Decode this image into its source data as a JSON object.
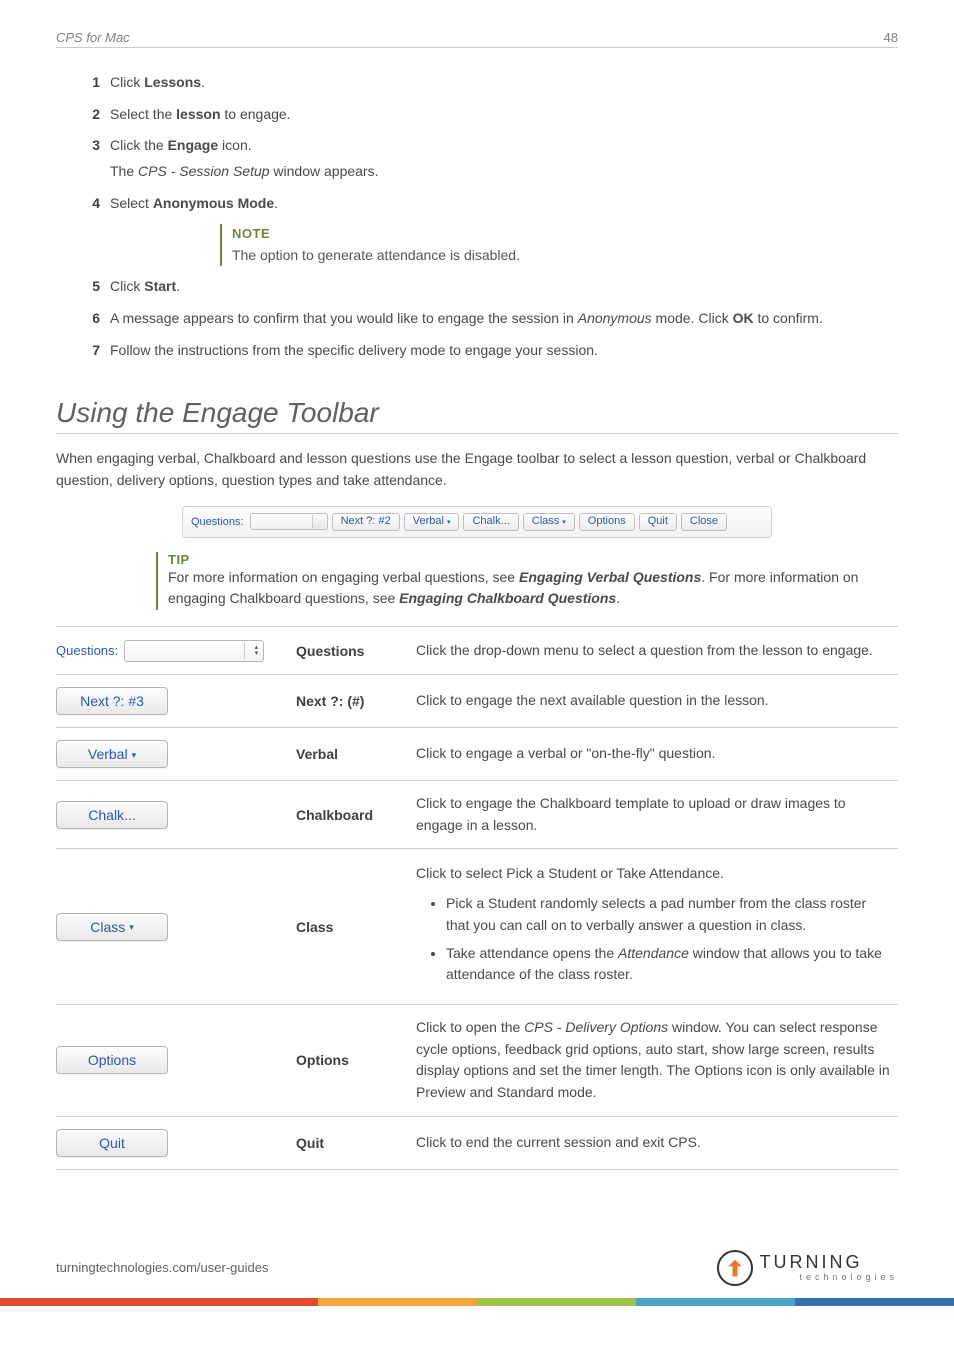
{
  "header": {
    "product": "CPS for Mac",
    "page_number": "48"
  },
  "steps": [
    {
      "num": "1",
      "body": [
        [
          "Click ",
          ""
        ],
        [
          "Lessons",
          "b"
        ],
        [
          ".",
          ""
        ]
      ]
    },
    {
      "num": "2",
      "body": [
        [
          "Select the ",
          ""
        ],
        [
          "lesson",
          "b"
        ],
        [
          " to engage.",
          ""
        ]
      ]
    },
    {
      "num": "3",
      "body": [
        [
          "Click the ",
          ""
        ],
        [
          "Engage",
          "b"
        ],
        [
          " icon.",
          ""
        ]
      ],
      "sub": [
        [
          "The ",
          ""
        ],
        [
          "CPS - Session Setup",
          "i"
        ],
        [
          " window appears.",
          ""
        ]
      ]
    },
    {
      "num": "4",
      "body": [
        [
          "Select ",
          ""
        ],
        [
          "Anonymous Mode",
          "b"
        ],
        [
          ".",
          ""
        ]
      ]
    },
    {
      "num": "5",
      "body": [
        [
          "Click ",
          ""
        ],
        [
          "Start",
          "b"
        ],
        [
          ".",
          ""
        ]
      ]
    },
    {
      "num": "6",
      "body": [
        [
          "A message appears to confirm that you would like to engage the session in ",
          ""
        ],
        [
          "Anonymous",
          "i"
        ],
        [
          " mode. Click ",
          ""
        ],
        [
          "OK",
          "b"
        ],
        [
          " to confirm.",
          ""
        ]
      ]
    },
    {
      "num": "7",
      "body": [
        [
          "Follow the instructions from the specific delivery mode to engage your session.",
          ""
        ]
      ]
    }
  ],
  "note": {
    "title": "NOTE",
    "body": "The option to generate attendance is disabled.",
    "after_step_index": 3
  },
  "section": {
    "title": "Using the Engage Toolbar",
    "intro": "When engaging verbal, Chalkboard and lesson questions use the Engage toolbar to select a lesson question, verbal or Chalkboard question, delivery options, question types and take attendance."
  },
  "toolbar": {
    "questions_label": "Questions:",
    "buttons": {
      "next": "Next ?: #2",
      "verbal": "Verbal",
      "chalk": "Chalk...",
      "class": "Class",
      "options": "Options",
      "quit": "Quit",
      "close": "Close"
    }
  },
  "tip": {
    "title": "TIP",
    "parts": [
      [
        "For more information on engaging verbal questions, see ",
        ""
      ],
      [
        "Engaging Verbal Questions",
        "bi"
      ],
      [
        ". For more information on engaging Chalkboard questions, see ",
        ""
      ],
      [
        "Engaging Chalkboard Questions",
        "bi"
      ],
      [
        ".",
        ""
      ]
    ]
  },
  "reference": [
    {
      "img_type": "select",
      "img_label": "Questions:",
      "name": "Questions",
      "desc": [
        [
          "Click the drop-down menu to select a question from the lesson to engage.",
          ""
        ]
      ]
    },
    {
      "img_type": "button",
      "img_label": "Next ?: #3",
      "name": "Next ?: (#)",
      "desc": [
        [
          "Click to engage the next available question in the lesson.",
          ""
        ]
      ]
    },
    {
      "img_type": "button_dd",
      "img_label": "Verbal",
      "name": "Verbal",
      "desc": [
        [
          "Click to engage a verbal or \"on-the-fly\" question.",
          ""
        ]
      ]
    },
    {
      "img_type": "button",
      "img_label": "Chalk...",
      "name": "Chalkboard",
      "desc": [
        [
          "Click to engage the Chalkboard template to upload or draw images to engage in a lesson.",
          ""
        ]
      ]
    },
    {
      "img_type": "button_dd",
      "img_label": "Class",
      "name": "Class",
      "desc": [
        [
          "Click to select Pick a Student or Take Attendance.",
          ""
        ]
      ],
      "bullets": [
        [
          [
            "Pick a Student randomly selects a pad number from the class roster that you can call on to verbally answer a question in class.",
            ""
          ]
        ],
        [
          [
            "Take attendance opens the ",
            ""
          ],
          [
            "Attendance",
            "i"
          ],
          [
            " window that allows you to take attendance of the class roster.",
            ""
          ]
        ]
      ]
    },
    {
      "img_type": "button",
      "img_label": "Options",
      "name": "Options",
      "desc": [
        [
          "Click to open the ",
          ""
        ],
        [
          "CPS - Delivery Options",
          "i"
        ],
        [
          " window. You can select response cycle options, feedback grid options, auto start, show large screen, results display options and set the timer length. The Options icon is only available in Preview and Standard mode.",
          ""
        ]
      ]
    },
    {
      "img_type": "button",
      "img_label": "Quit",
      "name": "Quit",
      "desc": [
        [
          "Click to end the current session and exit CPS.",
          ""
        ]
      ]
    }
  ],
  "footer": {
    "url": "turningtechnologies.com/user-guides",
    "logo_top": "TURNING",
    "logo_bottom": "technologies"
  }
}
